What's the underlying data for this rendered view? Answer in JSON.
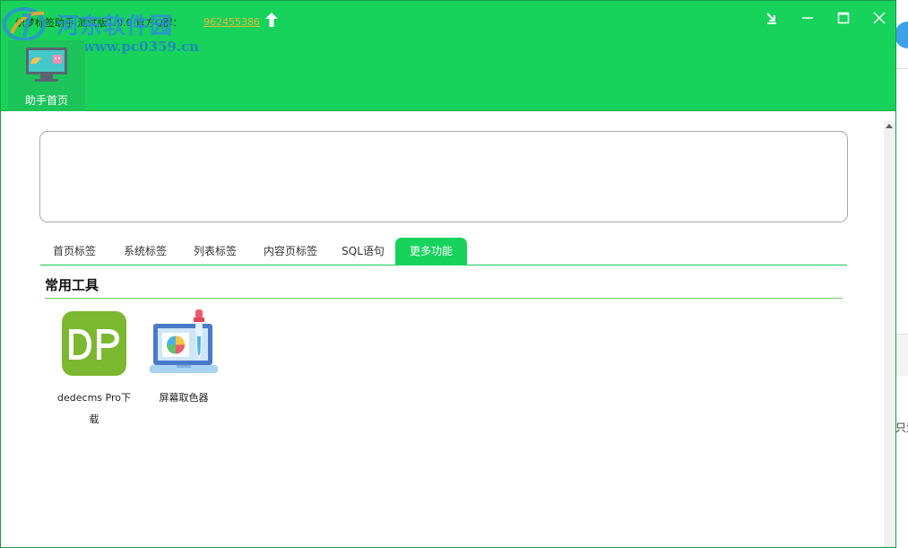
{
  "window": {
    "title": "织梦标签助手 测试版1.0.0 官方Q群：",
    "qq_group": "962455386"
  },
  "watermark": {
    "site_name": "河东软件园",
    "url": "www.pc0359.cn"
  },
  "nav": {
    "items": [
      {
        "label": "助手首页",
        "active": true
      }
    ]
  },
  "editor": {
    "value": ""
  },
  "tabs": [
    {
      "label": "首页标签",
      "active": false
    },
    {
      "label": "系统标签",
      "active": false
    },
    {
      "label": "列表标签",
      "active": false
    },
    {
      "label": "内容页标签",
      "active": false
    },
    {
      "label": "SQL语句",
      "active": false
    },
    {
      "label": "更多功能",
      "active": true
    }
  ],
  "section": {
    "title": "常用工具"
  },
  "tools": [
    {
      "label": "dedecms Pro下载",
      "icon": "dp-logo-icon"
    },
    {
      "label": "屏幕取色器",
      "icon": "color-picker-icon"
    }
  ],
  "colors": {
    "header_green": "#17d35b",
    "accent_green": "#17c85a",
    "link_orange": "#e8b43a",
    "dp_green": "#7cb82f"
  },
  "outside": {
    "fragment": "只爱"
  }
}
